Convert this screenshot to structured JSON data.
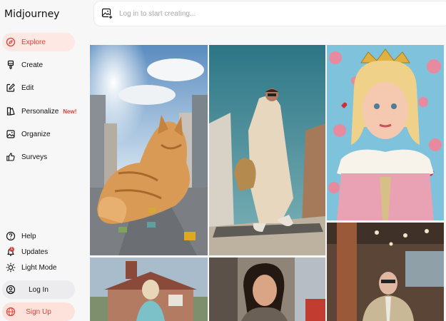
{
  "app": {
    "title": "Midjourney"
  },
  "sidebar": {
    "items": [
      {
        "label": "Explore",
        "icon": "compass-icon",
        "active": true
      },
      {
        "label": "Create",
        "icon": "brush-icon"
      },
      {
        "label": "Edit",
        "icon": "edit-icon"
      },
      {
        "label": "Personalize",
        "icon": "personalize-icon",
        "badge": "New!"
      },
      {
        "label": "Organize",
        "icon": "image-folder-icon"
      },
      {
        "label": "Surveys",
        "icon": "thumbs-up-icon"
      }
    ],
    "bottom": [
      {
        "label": "Help",
        "icon": "help-icon"
      },
      {
        "label": "Updates",
        "icon": "bell-icon",
        "count": "1"
      },
      {
        "label": "Light Mode",
        "icon": "sun-icon"
      }
    ],
    "login_label": "Log In",
    "signup_label": "Sign Up"
  },
  "search": {
    "placeholder": "Log in to start creating..."
  },
  "colors": {
    "accent": "#e0413a",
    "active_bg": "#fde8e4"
  }
}
